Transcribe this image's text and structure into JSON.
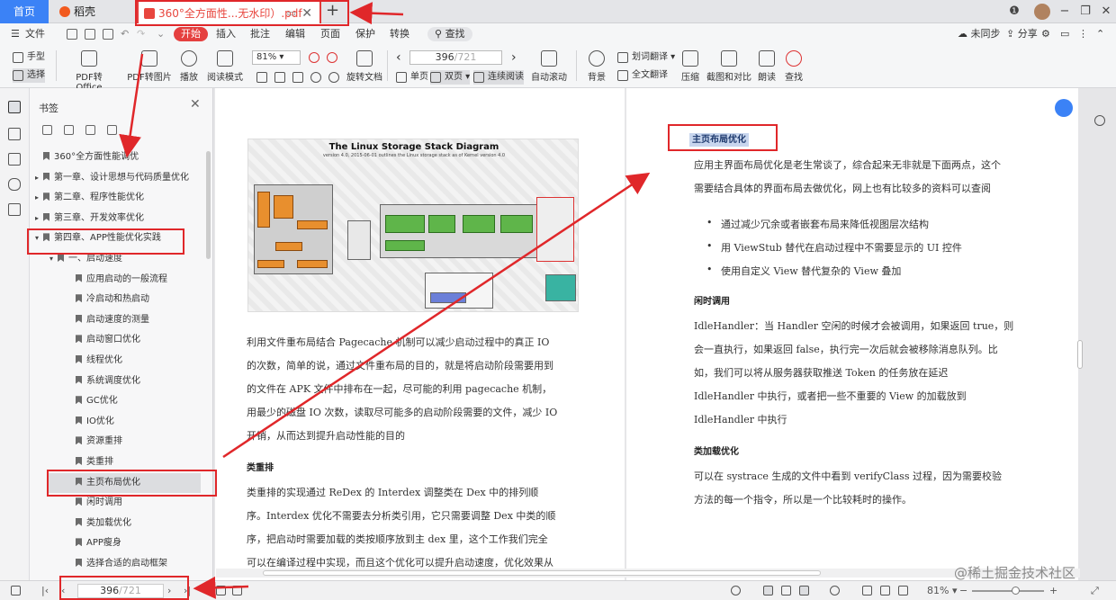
{
  "tabs": {
    "home": "首页",
    "docer": "稻壳",
    "pdf": "360°全方面性...无水印）.pdf"
  },
  "menu": {
    "file": "文件",
    "items": [
      "开始",
      "插入",
      "批注",
      "编辑",
      "页面",
      "保护",
      "转换"
    ],
    "search": "查找",
    "unsynced": "未同步",
    "share": "分享"
  },
  "ribbon": {
    "hand": "手型",
    "select": "选择",
    "pdf_to_office": "PDF转Office",
    "pdf_to_image": "PDF转图片",
    "play": "播放",
    "read_mode": "阅读模式",
    "zoom": "81%",
    "rotate": "旋转文档",
    "single": "单页",
    "double": "双页",
    "continuous": "连续阅读",
    "page_current": "396",
    "page_total": "/721",
    "auto_scroll": "自动滚动",
    "background": "背景",
    "word_translate": "划词翻译",
    "full_translate": "全文翻译",
    "compress": "压缩",
    "screenshot_compare": "截图和对比",
    "read_aloud": "朗读",
    "find": "查找"
  },
  "bookmarks": {
    "title": "书签",
    "items": [
      {
        "label": "360°全方面性能调优",
        "level": 0,
        "arrow": ""
      },
      {
        "label": "第一章、设计思想与代码质量优化",
        "level": 0,
        "arrow": "▸"
      },
      {
        "label": "第二章、程序性能优化",
        "level": 0,
        "arrow": "▸"
      },
      {
        "label": "第三章、开发效率优化",
        "level": 0,
        "arrow": "▸"
      },
      {
        "label": "第四章、APP性能优化实践",
        "level": 0,
        "arrow": "▾"
      },
      {
        "label": "一、启动速度",
        "level": 1,
        "arrow": "▾"
      },
      {
        "label": "应用启动的一般流程",
        "level": 2,
        "arrow": ""
      },
      {
        "label": "冷启动和热启动",
        "level": 2,
        "arrow": ""
      },
      {
        "label": "启动速度的测量",
        "level": 2,
        "arrow": ""
      },
      {
        "label": "启动窗口优化",
        "level": 2,
        "arrow": ""
      },
      {
        "label": "线程优化",
        "level": 2,
        "arrow": ""
      },
      {
        "label": "系统调度优化",
        "level": 2,
        "arrow": ""
      },
      {
        "label": "GC优化",
        "level": 2,
        "arrow": ""
      },
      {
        "label": "IO优化",
        "level": 2,
        "arrow": ""
      },
      {
        "label": "资源重排",
        "level": 2,
        "arrow": ""
      },
      {
        "label": "类重排",
        "level": 2,
        "arrow": ""
      },
      {
        "label": "主页布局优化",
        "level": 2,
        "arrow": ""
      },
      {
        "label": "闲时调用",
        "level": 2,
        "arrow": ""
      },
      {
        "label": "类加载优化",
        "level": 2,
        "arrow": ""
      },
      {
        "label": "APP瘦身",
        "level": 2,
        "arrow": ""
      },
      {
        "label": "选择合适的启动框架",
        "level": 2,
        "arrow": ""
      }
    ]
  },
  "left_page": {
    "diagram_title": "The Linux Storage Stack Diagram",
    "diagram_sub": "version 4.0, 2015-06-01 outlines the Linux storage stack as of Kernel version 4.0",
    "para1": [
      "利用文件重布局结合 Pagecache 机制可以减少启动过程中的真正 IO",
      "的次数，简单的说，通过文件重布局的目的，就是将启动阶段需要用到",
      "的文件在 APK 文件中排布在一起，尽可能的利用 pagecache 机制，",
      "用最少的磁盘 IO 次数，读取尽可能多的启动阶段需要的文件，减少 IO",
      "开销，从而达到提升启动性能的目的"
    ],
    "heading": "类重排",
    "para2": [
      "类重排的实现通过 ReDex 的 Interdex 调整类在 Dex 中的排列顺",
      "序。Interdex 优化不需要去分析类引用，它只需要调整 Dex 中类的顺",
      "序，把启动时需要加载的类按顺序放到主 dex 里，这个工作我们完全",
      "可以在编译过程中实现，而且这个优化可以提升启动速度，优化效果从"
    ]
  },
  "right_page": {
    "heading": "主页布局优化",
    "para1": [
      "应用主界面布局优化是老生常谈了，综合起来无非就是下面两点，这个",
      "需要结合具体的界面布局去做优化，网上也有比较多的资料可以查阅"
    ],
    "bullets": [
      "通过减少冗余或者嵌套布局来降低视图层次结构",
      "用 ViewStub 替代在启动过程中不需要显示的 UI 控件",
      "使用自定义 View 替代复杂的 View 叠加"
    ],
    "heading2": "闲时调用",
    "para2": [
      "IdleHandler：当 Handler 空闲的时候才会被调用，如果返回 true，则",
      "会一直执行，如果返回 false，执行完一次后就会被移除消息队列。比",
      "如，我们可以将从服务器获取推送 Token 的任务放在延迟",
      "IdleHandler 中执行，或者把一些不重要的 View 的加载放到",
      "IdleHandler 中执行"
    ],
    "heading3": "类加载优化",
    "para3": [
      "可以在 systrace 生成的文件中看到 verifyClass 过程，因为需要校验",
      "方法的每一个指令，所以是一个比较耗时的操作。"
    ]
  },
  "status": {
    "page_current": "396",
    "page_total": "/721",
    "zoom": "81%",
    "watermark": "@稀土掘金技术社区"
  },
  "colors": {
    "accent": "#e5403f",
    "annotation": "#e0272a",
    "home_tab": "#3b82f6"
  }
}
